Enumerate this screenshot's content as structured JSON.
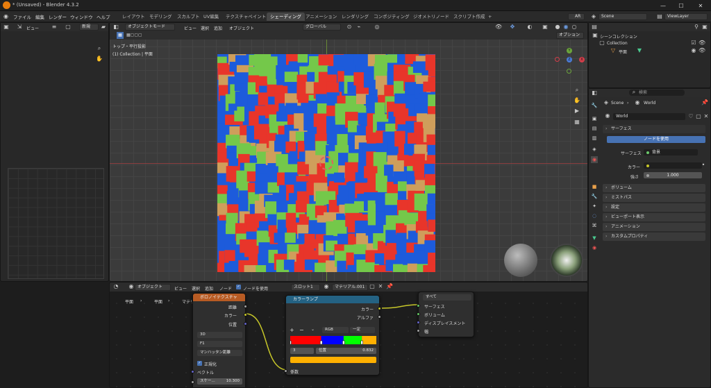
{
  "window": {
    "title": "* (Unsaved) - Blender 4.3.2",
    "minimize": "—",
    "maximize": "☐",
    "close": "✕"
  },
  "menu": [
    "ファイル",
    "編集",
    "レンダー",
    "ウィンドウ",
    "ヘルプ"
  ],
  "workspaces": [
    "レイアウト",
    "モデリング",
    "スカルプト",
    "UV編集",
    "テクスチャペイント",
    "シェーディング",
    "アニメーション",
    "レンダリング",
    "コンポジティング",
    "ジオメトリノード",
    "スクリプト作成",
    "+"
  ],
  "active_workspace": "シェーディング",
  "topright": {
    "ar": "AR",
    "scene": "Scene",
    "viewlayer": "ViewLayer"
  },
  "image_editor": {
    "view": "ビュー",
    "new": "新規"
  },
  "viewport": {
    "mode": "オブジェクトモード",
    "menus": [
      "ビュー",
      "選択",
      "追加",
      "オブジェクト"
    ],
    "transform": "グローバル",
    "options": "オプション",
    "view_name": "トップ・平行投影",
    "collection": "(1) Collection | 平面",
    "axis": {
      "x": "X",
      "y": "Y",
      "z": "Z"
    }
  },
  "outliner": {
    "scene_collection": "シーンコレクション",
    "collection": "Collection",
    "object": "平面"
  },
  "properties": {
    "search_placeholder": "検索",
    "breadcrumb": [
      "Scene",
      "World"
    ],
    "world_name": "World",
    "surface_header": "サーフェス",
    "use_nodes": "ノードを使用",
    "surface_label": "サーフェス",
    "surface_value": "背景",
    "color_label": "カラー",
    "strength_label": "強さ",
    "strength_value": "1.000",
    "collapsed": [
      "ボリューム",
      "ミストパス",
      "設定",
      "ビューポート表示",
      "アニメーション",
      "カスタムプロパティ"
    ]
  },
  "node_editor": {
    "object": "オブジェクト",
    "menus": [
      "ビュー",
      "選択",
      "追加",
      "ノード"
    ],
    "use_nodes": "ノードを使用",
    "slot": "スロット1",
    "material": "マテリアル.001",
    "breadcrumb": [
      "平面",
      "平面",
      "マテリアル.001"
    ]
  },
  "voronoi": {
    "title": "ボロノイテクスチャ",
    "outputs": [
      "距離",
      "カラー",
      "位置"
    ],
    "dim": "3D",
    "feature": "F1",
    "metric": "マンハッタン距離",
    "normalize": "正規化",
    "vector": "ベクトル",
    "scale_label": "スケー...",
    "scale_value": "10.300"
  },
  "colorramp": {
    "title": "カラーランプ",
    "outputs": [
      "カラー",
      "アルファ"
    ],
    "plus": "+",
    "minus": "−",
    "mode": "RGB",
    "interp": "一定",
    "index": "3",
    "pos_label": "位置",
    "pos_value": "0.832",
    "input": "係数",
    "stops": [
      {
        "color": "#ff0000",
        "pos": 0.0
      },
      {
        "color": "#0000ff",
        "pos": 0.36
      },
      {
        "color": "#00ff00",
        "pos": 0.62
      },
      {
        "color": "#ffb000",
        "pos": 0.832
      }
    ]
  },
  "output_node": {
    "target": "すべて",
    "inputs": [
      "サーフェス",
      "ボリューム",
      "ディスプレイスメント",
      "幅"
    ]
  },
  "colors": {
    "red": "#e8352a",
    "blue": "#1d5bdb",
    "green": "#74c84a",
    "tan": "#cf9e5b",
    "accent": "#4772b3",
    "node_orange": "#b85b23",
    "node_teal": "#246283"
  }
}
